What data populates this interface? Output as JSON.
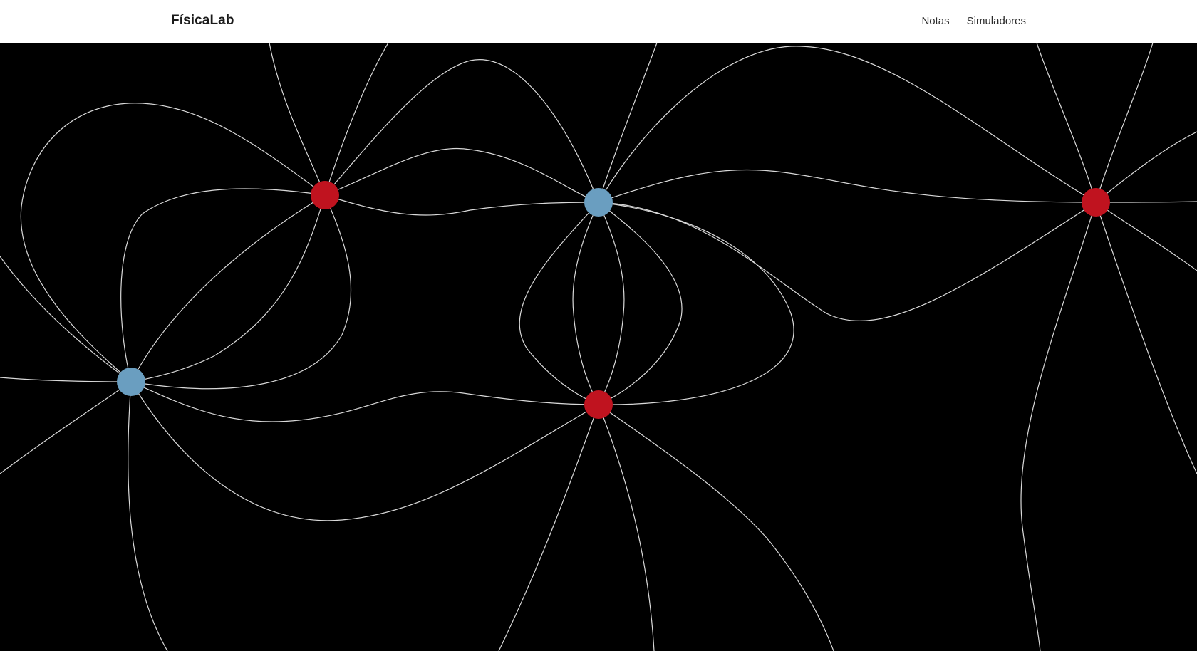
{
  "header": {
    "brand": "FísicaLab",
    "nav": [
      {
        "label": "Notas"
      },
      {
        "label": "Simuladores"
      }
    ]
  },
  "simulation": {
    "background_color": "#000000",
    "field_line_color": "#d9d9d9",
    "charges": [
      {
        "id": "charge-1",
        "sign": "positive",
        "color": "#c0131f"
      },
      {
        "id": "charge-2",
        "sign": "negative",
        "color": "#6a9ec0"
      },
      {
        "id": "charge-3",
        "sign": "negative",
        "color": "#6a9ec0"
      },
      {
        "id": "charge-4",
        "sign": "positive",
        "color": "#c0131f"
      },
      {
        "id": "charge-5",
        "sign": "positive",
        "color": "#c0131f"
      }
    ]
  }
}
